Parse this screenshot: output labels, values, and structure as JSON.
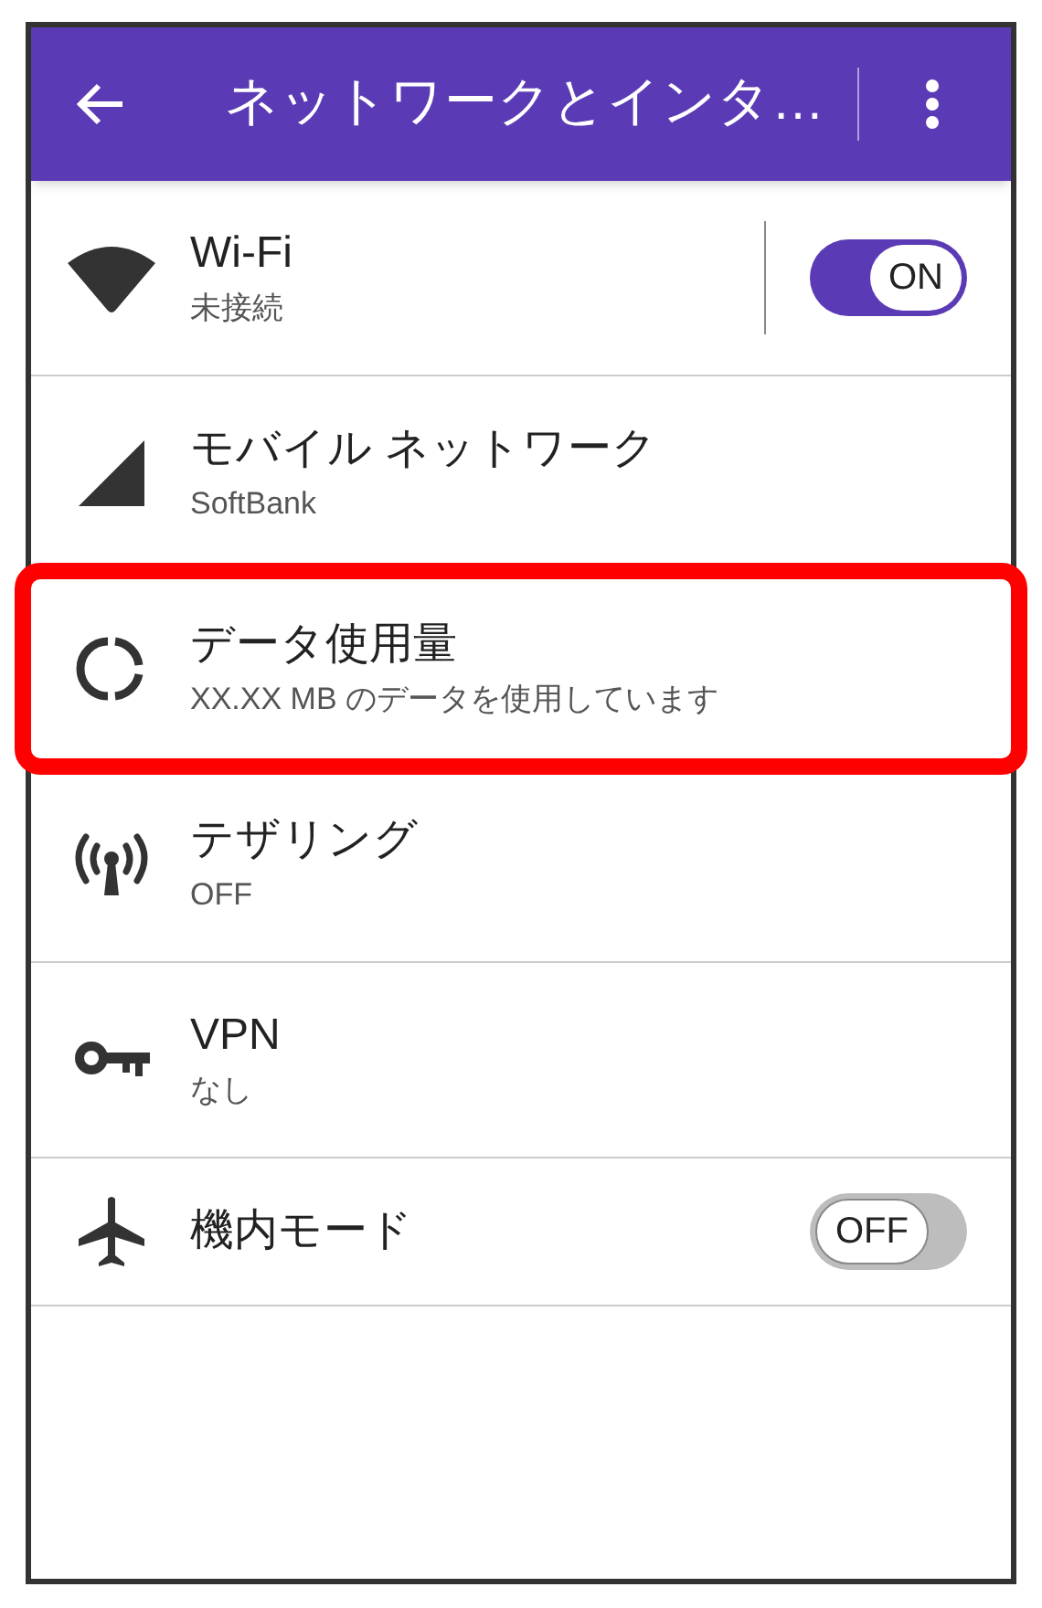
{
  "app_bar": {
    "title": "ネットワークとインタ…"
  },
  "settings": [
    {
      "kind": "toggle",
      "title": "Wi-Fi",
      "subtitle": "未接続",
      "toggle": {
        "on": true,
        "label": "ON"
      },
      "highlighted": false
    },
    {
      "kind": "plain",
      "title": "モバイル ネットワーク",
      "subtitle": "SoftBank",
      "highlighted": false
    },
    {
      "kind": "plain",
      "title": "データ使用量",
      "subtitle": "XX.XX MB のデータを使用しています",
      "highlighted": true
    },
    {
      "kind": "plain",
      "title": "テザリング",
      "subtitle": "OFF",
      "highlighted": false
    },
    {
      "kind": "plain",
      "title": "VPN",
      "subtitle": "なし",
      "highlighted": false
    },
    {
      "kind": "toggle",
      "title": "機内モード",
      "toggle": {
        "on": false,
        "label": "OFF"
      },
      "highlighted": false
    }
  ]
}
